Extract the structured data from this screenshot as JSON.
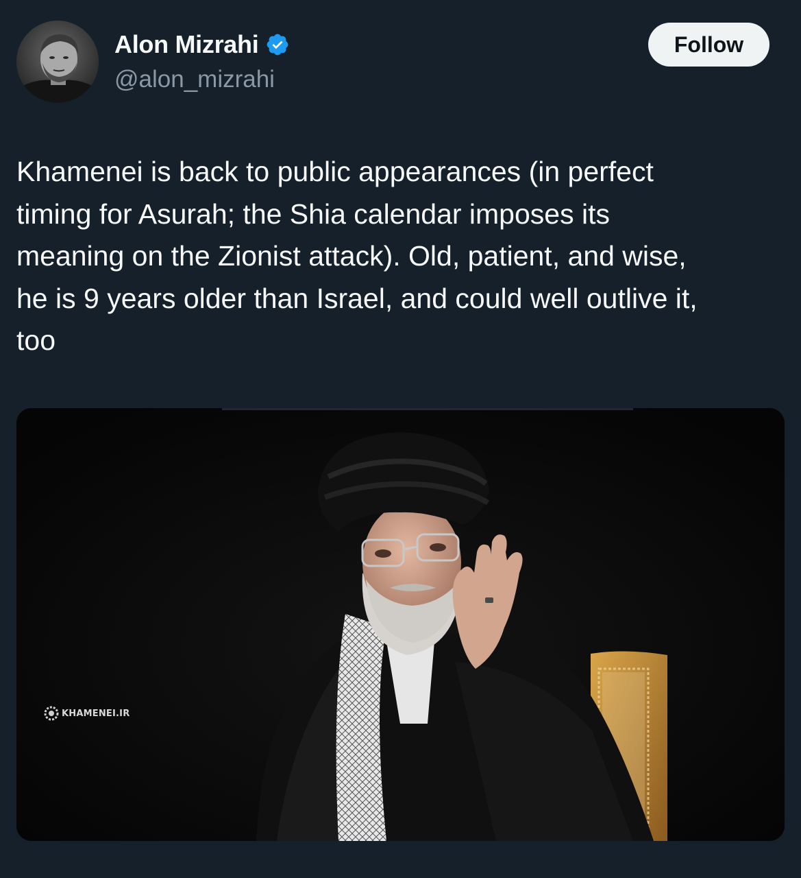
{
  "author": {
    "display_name": "Alon Mizrahi",
    "handle": "@alon_mizrahi",
    "verified": true,
    "avatar_icon": "profile-photo"
  },
  "follow_button": {
    "label": "Follow"
  },
  "tweet": {
    "text": "Khamenei is back to public appearances (in perfect\ntiming for Asurah; the Shia calendar imposes its\nmeaning on the Zionist attack). Old, patient, and wise,\nhe is 9 years older than Israel, and could well outlive it,\ntoo"
  },
  "media": {
    "watermark": "KHAMENEI.IR",
    "watermark_icon": "gear-logo-icon"
  },
  "colors": {
    "background": "#15202b",
    "primary_text": "#f7f9f9",
    "secondary_text": "#8b98a5",
    "verified_badge": "#1d9bf0",
    "follow_button_bg": "#eff3f4",
    "follow_button_text": "#0f1419"
  }
}
